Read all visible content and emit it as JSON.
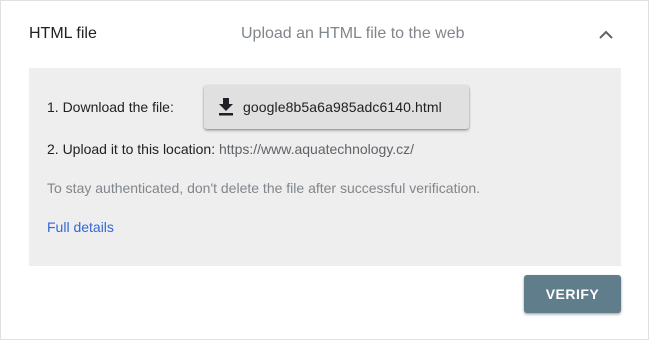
{
  "header": {
    "title": "HTML file",
    "description": "Upload an HTML file to the web",
    "collapse_icon": "chevron-up-icon"
  },
  "panel": {
    "step1_label": "1. Download the file:",
    "download_icon": "download-icon",
    "download_filename": "google8b5a6a985adc6140.html",
    "step2_label": "2. Upload it to this location:",
    "step2_url": "https://www.aquatechnology.cz/",
    "note": "To stay authenticated, don't delete the file after successful verification.",
    "details_link": "Full details"
  },
  "actions": {
    "verify_label": "VERIFY"
  },
  "colors": {
    "panel_background": "#eeeeee",
    "verify_button": "#607d8b",
    "link": "#3367d6"
  }
}
